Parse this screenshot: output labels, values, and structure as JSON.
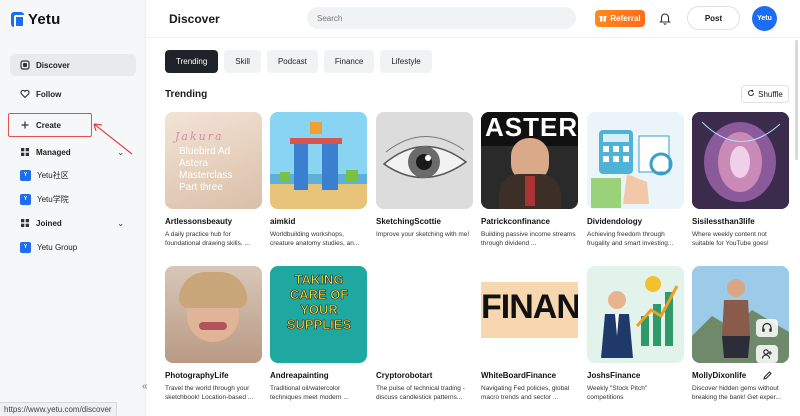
{
  "app": {
    "logo_text": "Yetu"
  },
  "sidebar": {
    "items": [
      {
        "label": "Discover",
        "icon": "discover-icon"
      },
      {
        "label": "Follow",
        "icon": "heart-icon"
      },
      {
        "label": "Create",
        "icon": "plus-icon"
      },
      {
        "label": "Managed",
        "icon": "grid-icon"
      },
      {
        "label": "Yetu社区",
        "icon": "yetu-icon"
      },
      {
        "label": "Yetu学院",
        "icon": "yetu-icon"
      },
      {
        "label": "Joined",
        "icon": "grid-icon"
      },
      {
        "label": "Yetu Group",
        "icon": "yetu-icon"
      }
    ],
    "collapse": "«"
  },
  "status_bar": {
    "url": "https://www.yetu.com/discover"
  },
  "header": {
    "title": "Discover",
    "search_placeholder": "Search",
    "referral_label": "Referral",
    "post_label": "Post",
    "avatar_text": "Yetu"
  },
  "filters": [
    "Trending",
    "Skill",
    "Podcast",
    "Finance",
    "Lifestyle"
  ],
  "section": {
    "title": "Trending",
    "shuffle_label": "Shuffle"
  },
  "cards": [
    {
      "title": "Artlessonsbeauty",
      "desc": "A daily practice hub for foundational drawing skills. ...",
      "thumb_text": "Bluebird Ad Astera Masterclass Part three"
    },
    {
      "title": "aimkid",
      "desc": "Worldbuilding workshops, creature anatomy studies, an..."
    },
    {
      "title": "SketchingScottie",
      "desc": "Improve your sketching with me!"
    },
    {
      "title": "Patrickconfinance",
      "desc": "Building passive income streams through dividend ...",
      "thumb_text": "ASTER"
    },
    {
      "title": "Dividendology",
      "desc": "Achieving freedom through frugality and smart investing..."
    },
    {
      "title": "Sisilessthan3life",
      "desc": "Where weekly content not suitable for YouTube goes!"
    },
    {
      "title": "PhotographyLife",
      "desc": "Travel the world through your sketchbook! Location-based ..."
    },
    {
      "title": "Andreapainting",
      "desc": "Traditional oil/watercolor techniques meet modern ...",
      "thumb_text": "TAKING CARE OF YOUR SUPPLIES"
    },
    {
      "title": "Cryptorobotart",
      "desc": "The pulse of technical trading - discuss candlestick patterns..."
    },
    {
      "title": "WhiteBoardFinance",
      "desc": "Navigating Fed policies, global macro trends and sector ...",
      "thumb_text": "FINAN"
    },
    {
      "title": "JoshsFinance",
      "desc": "Weekly \"Stock Pitch\" competitions"
    },
    {
      "title": "MollyDixonlife",
      "desc": "Discover hidden gems without breaking the bank! Get exper..."
    }
  ],
  "colors": {
    "accent": "#1b6ef3",
    "referral": "#ff7a1f",
    "highlight_box": "#e45050"
  }
}
